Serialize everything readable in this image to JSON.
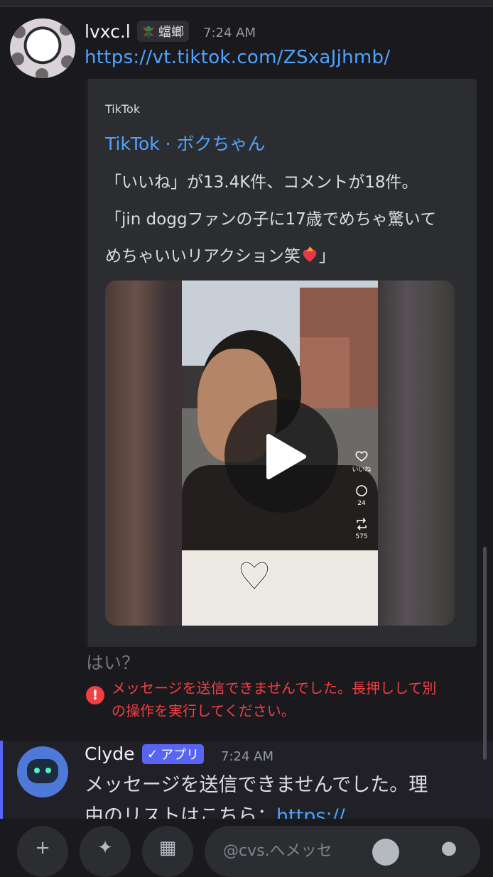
{
  "message1": {
    "username": "lvxc.l",
    "badge_label": "蟷螂",
    "timestamp": "7:24 AM",
    "link": "https://vt.tiktok.com/ZSxaJjhmb/"
  },
  "embed": {
    "provider": "TikTok",
    "title": "TikTok · ボクちゃん",
    "desc_line1": "「いいね」が13.4K件、コメントが18件。",
    "desc_line2": "「jin doggファンの子に17歳でめちゃ驚いて",
    "desc_line3a": "めちゃいいリアクション笑",
    "desc_line3b": "」",
    "video": {
      "like_label": "いいね",
      "comment_count": "24",
      "share_count": "575"
    }
  },
  "failed": {
    "text": "はい？",
    "error_line1": "メッセージを送信できませんでした。長押しして別",
    "error_line2": "の操作を実行してください。"
  },
  "clyde": {
    "name": "Clyde",
    "badge": "アプリ",
    "timestamp": "7:24 AM",
    "line1": "メッセージを送信できませんでした。理",
    "line2": "由のリストはこちら：",
    "line2_link": "https://"
  },
  "bottom": {
    "input_placeholder": "@cvs.へメッセ"
  }
}
